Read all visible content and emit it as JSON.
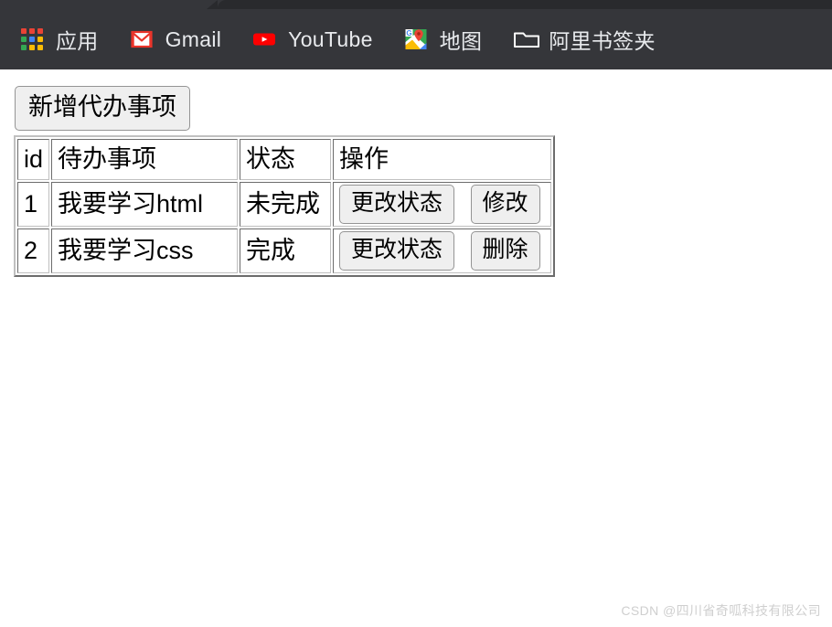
{
  "browser": {
    "bookmarks": [
      {
        "label": "应用",
        "icon": "apps-grid-icon"
      },
      {
        "label": "Gmail",
        "icon": "gmail-icon"
      },
      {
        "label": "YouTube",
        "icon": "youtube-icon"
      },
      {
        "label": "地图",
        "icon": "google-maps-icon"
      },
      {
        "label": "阿里书签夹",
        "icon": "folder-icon"
      }
    ],
    "bar_background": "#35363a",
    "tab_background": "#292a2d",
    "label_color": "#e8eaed"
  },
  "toolbar": {
    "add_todo_label": "新增代办事项"
  },
  "table": {
    "headers": [
      "id",
      "待办事项",
      "状态",
      "操作"
    ],
    "rows": [
      {
        "id": "1",
        "title": "我要学习html",
        "status": "未完成",
        "actions": [
          "更改状态",
          "修改"
        ]
      },
      {
        "id": "2",
        "title": "我要学习css",
        "status": "完成",
        "actions": [
          "更改状态",
          "删除"
        ]
      }
    ]
  },
  "watermark": {
    "text": "CSDN @四川省奇呱科技有限公司",
    "color": "#cfcfcf"
  },
  "colors": {
    "apps_grid": [
      "#ea4335",
      "#ea4335",
      "#ea4335",
      "#34a853",
      "#4285f4",
      "#fbbc05",
      "#34a853",
      "#fbbc05",
      "#fbbc05"
    ],
    "gmail_red": "#e9342a",
    "youtube_red": "#ff0000",
    "maps_green": "#34a853",
    "maps_blue": "#4285f4",
    "maps_yellow": "#fbbc05",
    "maps_pin": "#ea4335",
    "button_face": "#efefef",
    "button_border": "#949494"
  }
}
